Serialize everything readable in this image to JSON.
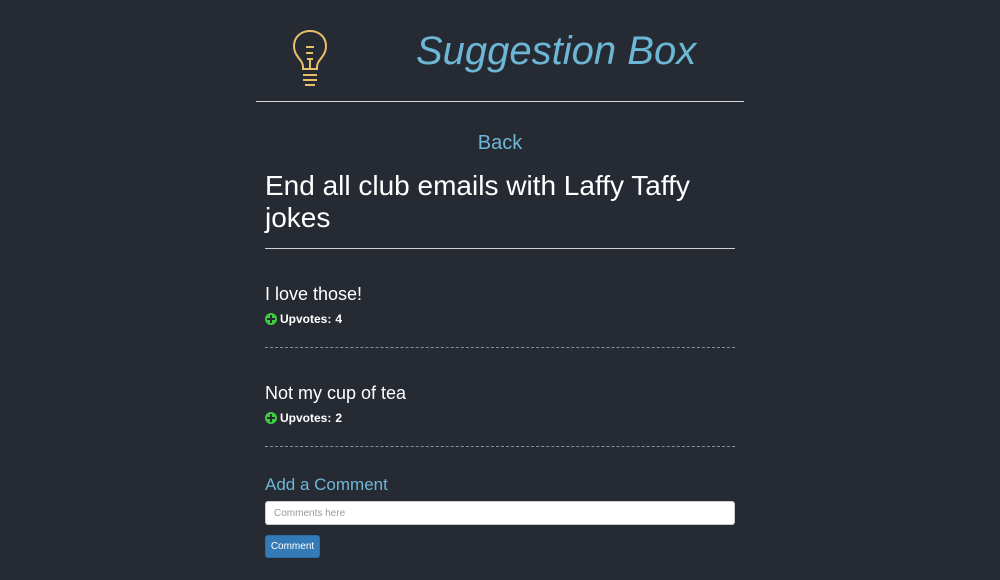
{
  "header": {
    "logo_icon": "lightbulb-icon",
    "title": "Suggestion Box"
  },
  "nav": {
    "back_label": "Back"
  },
  "suggestion": {
    "title": "End all club emails with Laffy Taffy jokes"
  },
  "comments": [
    {
      "text": "I love those!",
      "upvotes_label": "Upvotes:",
      "upvotes": "4"
    },
    {
      "text": "Not my cup of tea",
      "upvotes_label": "Upvotes:",
      "upvotes": "2"
    }
  ],
  "add_comment": {
    "heading": "Add a Comment",
    "placeholder": "Comments here",
    "value": "",
    "button_label": "Comment"
  },
  "colors": {
    "background": "#262a33",
    "accent": "#6db7d6",
    "bulb": "#e8c06a",
    "upvote": "#3fcb3f",
    "button": "#337ab7"
  }
}
